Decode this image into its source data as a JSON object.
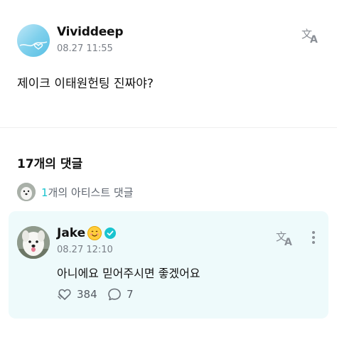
{
  "post": {
    "author": "Vividdeep",
    "timestamp": "08.27 11:55",
    "body": "제이크 이태원헌팅 진짜야?",
    "avatar_icon": "heart-logo-avatar",
    "translate_icon": "translate-icon"
  },
  "comments_header": {
    "title": "17개의 댓글"
  },
  "artist_comments": {
    "count": "1",
    "label": "개의 아티스트 댓글"
  },
  "featured_comment": {
    "author": "Jake",
    "timestamp": "08.27 12:10",
    "text": "아니에요 믿어주시면 좋겠어요",
    "likes": "384",
    "replies": "7",
    "emoji_icon": "smile-emoji-icon",
    "verified_icon": "verified-badge-icon"
  },
  "colors": {
    "accent": "#19c4cf",
    "card_bg": "#eefafb",
    "muted_text": "#7a7f87"
  }
}
